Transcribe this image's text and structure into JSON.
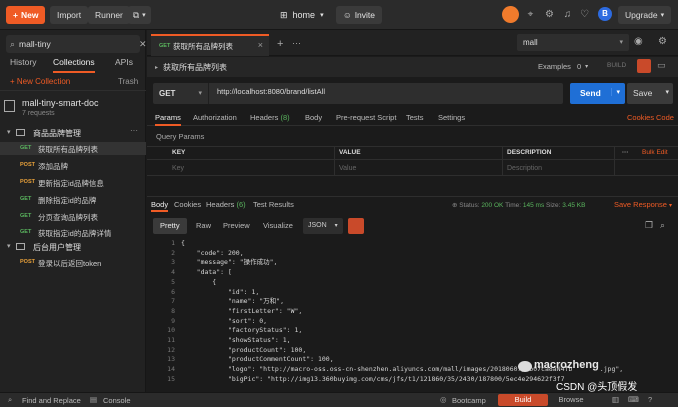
{
  "colors": {
    "accent": "#ef5b25",
    "send": "#1f6fd6",
    "get": "#5ab55e",
    "post": "#e8a13a",
    "bg": "#1b1b1b"
  },
  "topbar": {
    "new_label": "New",
    "import_label": "Import",
    "runner_label": "Runner",
    "workspace_label": "home",
    "invite_label": "Invite",
    "upgrade_label": "Upgrade",
    "avatar_letter": "B"
  },
  "sidebar": {
    "search_value": "mall-tiny",
    "tabs": [
      "History",
      "Collections",
      "APIs"
    ],
    "new_collection_label": "+ New Collection",
    "trash_label": "Trash",
    "collection": {
      "title": "mall-tiny-smart-doc",
      "subtitle": "7 requests"
    },
    "folders": [
      {
        "name": "商品品牌管理",
        "requests": [
          {
            "method": "GET",
            "name": "获取所有品牌列表"
          },
          {
            "method": "POST",
            "name": "添加品牌"
          },
          {
            "method": "POST",
            "name": "更新指定id品牌信息"
          },
          {
            "method": "GET",
            "name": "删除指定id的品牌"
          },
          {
            "method": "GET",
            "name": "分页查询品牌列表"
          },
          {
            "method": "GET",
            "name": "获取指定id的品牌详情"
          }
        ]
      },
      {
        "name": "后台用户管理",
        "requests": [
          {
            "method": "POST",
            "name": "登录以后返回token"
          }
        ]
      }
    ]
  },
  "request": {
    "tab_method": "GET",
    "tab_title": "获取所有品牌列表",
    "title": "获取所有品牌列表",
    "examples_label": "Examples",
    "examples_count": "0",
    "build_label": "BUILD",
    "method": "GET",
    "url": "http://localhost:8080/brand/listAll",
    "send_label": "Send",
    "save_label": "Save",
    "tabs": {
      "params": "Params",
      "authorization": "Authorization",
      "headers": "Headers",
      "headers_count": "(8)",
      "body": "Body",
      "prerequest": "Pre-request Script",
      "tests": "Tests",
      "settings": "Settings"
    },
    "cookies_link": "Cookies",
    "code_link": "Code",
    "query_params_label": "Query Params",
    "table": {
      "headers": [
        "KEY",
        "VALUE",
        "DESCRIPTION"
      ],
      "placeholders": [
        "Key",
        "Value",
        "Description"
      ],
      "bulk_edit": "Bulk Edit"
    }
  },
  "environment": {
    "selected": "mall"
  },
  "response": {
    "tabs": {
      "body": "Body",
      "cookies": "Cookies",
      "headers": "Headers",
      "headers_count": "(6)",
      "test_results": "Test Results"
    },
    "status_label": "Status:",
    "status_value": "200 OK",
    "time_label": "Time:",
    "time_value": "145 ms",
    "size_label": "Size:",
    "size_value": "3.45 KB",
    "save_response_label": "Save Response",
    "format_buttons": [
      "Pretty",
      "Raw",
      "Preview",
      "Visualize"
    ],
    "format_select": "JSON",
    "code_lines": [
      {
        "n": "1",
        "text": "{"
      },
      {
        "n": "2",
        "text": "    \"code\": 200,"
      },
      {
        "n": "3",
        "text": "    \"message\": \"操作成功\","
      },
      {
        "n": "4",
        "text": "    \"data\": ["
      },
      {
        "n": "5",
        "text": "        {"
      },
      {
        "n": "6",
        "text": "            \"id\": 1,"
      },
      {
        "n": "7",
        "text": "            \"name\": \"万和\","
      },
      {
        "n": "8",
        "text": "            \"firstLetter\": \"W\","
      },
      {
        "n": "9",
        "text": "            \"sort\": 0,"
      },
      {
        "n": "10",
        "text": "            \"factoryStatus\": 1,"
      },
      {
        "n": "11",
        "text": "            \"showStatus\": 1,"
      },
      {
        "n": "12",
        "text": "            \"productCount\": 100,"
      },
      {
        "n": "13",
        "text": "            \"productCommentCount\": 100,"
      },
      {
        "n": "14",
        "text": "            \"logo\": \"http://macro-oss.oss-cn-shenzhen.aliyuncs.com/mall/images/20180607/5b07ca8aN4fb       .jpg\","
      },
      {
        "n": "15",
        "text": "            \"bigPic\": \"http://img13.360buyimg.com/cms/jfs/t1/121860/35/2430/187800/5ec4e294622f3f7"
      }
    ]
  },
  "watermark": {
    "line1": "macrozheng",
    "line2": "CSDN @头顶假发"
  },
  "statusbar": {
    "find_replace": "Find and Replace",
    "console": "Console",
    "bootcamp": "Bootcamp",
    "build": "Build",
    "browse": "Browse"
  }
}
